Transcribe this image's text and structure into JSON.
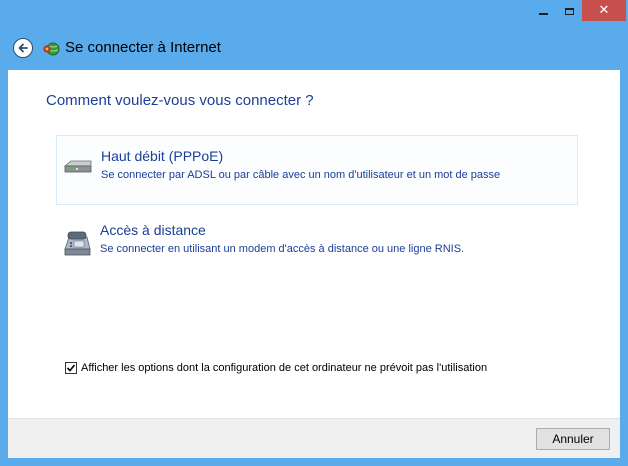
{
  "window": {
    "title": "Se connecter à Internet",
    "close_glyph": "✕",
    "colors": {
      "frame": "#5aabeb",
      "close": "#c7504f",
      "accent_text": "#1b3e97"
    }
  },
  "header": {
    "back_icon": "back-arrow-icon",
    "app_icon": "network-globe-icon"
  },
  "main": {
    "question": "Comment voulez-vous vous connecter ?",
    "options": [
      {
        "title": "Haut débit (PPPoE)",
        "description": "Se connecter par ADSL ou par câble avec un nom d'utilisateur et un mot de passe",
        "icon": "broadband-modem-icon"
      },
      {
        "title": "Accès à distance",
        "description": "Se connecter en utilisant un modem d'accès à distance ou une ligne RNIS.",
        "icon": "dialup-phone-icon"
      }
    ],
    "show_options_checkbox": {
      "label": "Afficher les options dont la configuration de cet ordinateur ne prévoit pas l'utilisation",
      "checked": true
    }
  },
  "footer": {
    "cancel_label": "Annuler"
  }
}
